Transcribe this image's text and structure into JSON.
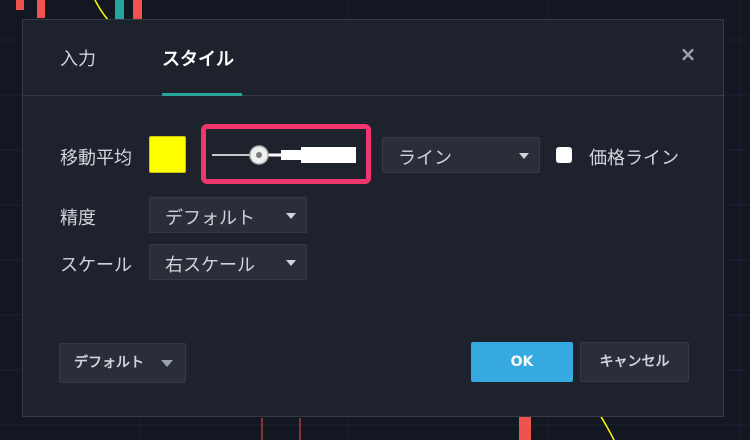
{
  "tabs": [
    {
      "label": "入力",
      "active": false
    },
    {
      "label": "スタイル",
      "active": true
    }
  ],
  "close_icon": "×",
  "rows": {
    "ma_label": "移動平均",
    "ma_color": "#ffff00",
    "line_type": "ライン",
    "price_line_label": "価格ライン",
    "price_line_checked": false,
    "precision_label": "精度",
    "precision_value": "デフォルト",
    "scale_label": "スケール",
    "scale_value": "右スケール"
  },
  "thickness_slider": {
    "value": 2,
    "max": 4
  },
  "footer": {
    "default_label": "デフォルト",
    "ok_label": "OK",
    "cancel_label": "キャンセル"
  },
  "colors": {
    "accent_tab": "#26a69a",
    "ok_button": "#36a9e1",
    "highlight": "#f1366d",
    "dialog_bg": "#1e222d",
    "candle_up": "#26a69a",
    "candle_down": "#ef5350"
  }
}
